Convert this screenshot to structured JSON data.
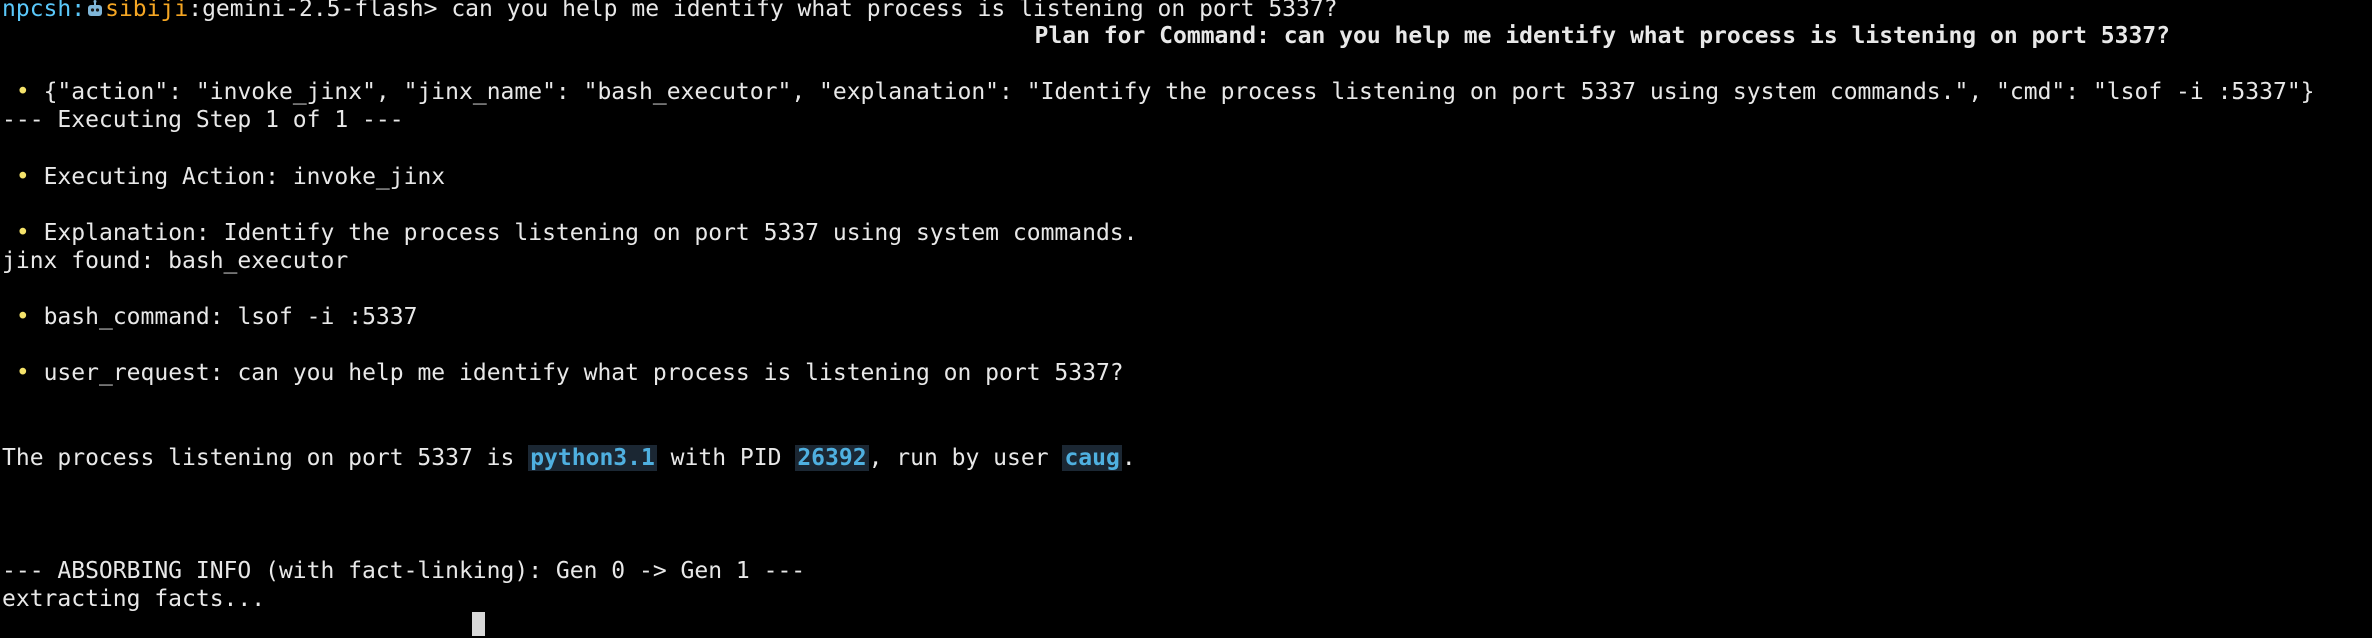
{
  "prompt": {
    "shell": "npcsh",
    "sep1": ":",
    "npc": "sibiji",
    "sep2": ":",
    "model": "gemini-2.5-flash",
    "caret": ">",
    "command": " can you help me identify what process is listening on port 5337?"
  },
  "plan_title": "Plan for Command: can you help me identify what process is listening on port 5337?",
  "action_line": "{\"action\": \"invoke_jinx\", \"jinx_name\": \"bash_executor\", \"explanation\": \"Identify the process listening on port 5337 using system commands.\", \"cmd\": \"lsof -i :5337\"}",
  "step_header": "--- Executing Step 1 of 1 ---",
  "exec_action": "Executing Action: invoke_jinx",
  "explanation": "Explanation: Identify the process listening on port 5337 using system commands.",
  "jinx_found": "jinx found: bash_executor",
  "bash_command": "bash_command: lsof -i :5337",
  "user_request": "user_request: can you help me identify what process is listening on port 5337?",
  "result": {
    "pre": "The process listening on port 5337 is ",
    "process": "python3.1",
    "mid1": " with PID ",
    "pid": "26392",
    "mid2": ", run by user ",
    "user": "caug",
    "post": "."
  },
  "absorb_header": "--- ABSORBING INFO (with fact-linking): Gen 0 -> Gen 1 ---",
  "extracting": "extracting facts...",
  "bullet_char": "•",
  "colors": {
    "background": "#000000",
    "text": "#e8e8e8",
    "shell": "#5ac8fa",
    "npc": "#f5a623",
    "bullet": "#f4e26a",
    "highlight": "#4fb0e0"
  },
  "icons": [
    "robot-icon"
  ]
}
